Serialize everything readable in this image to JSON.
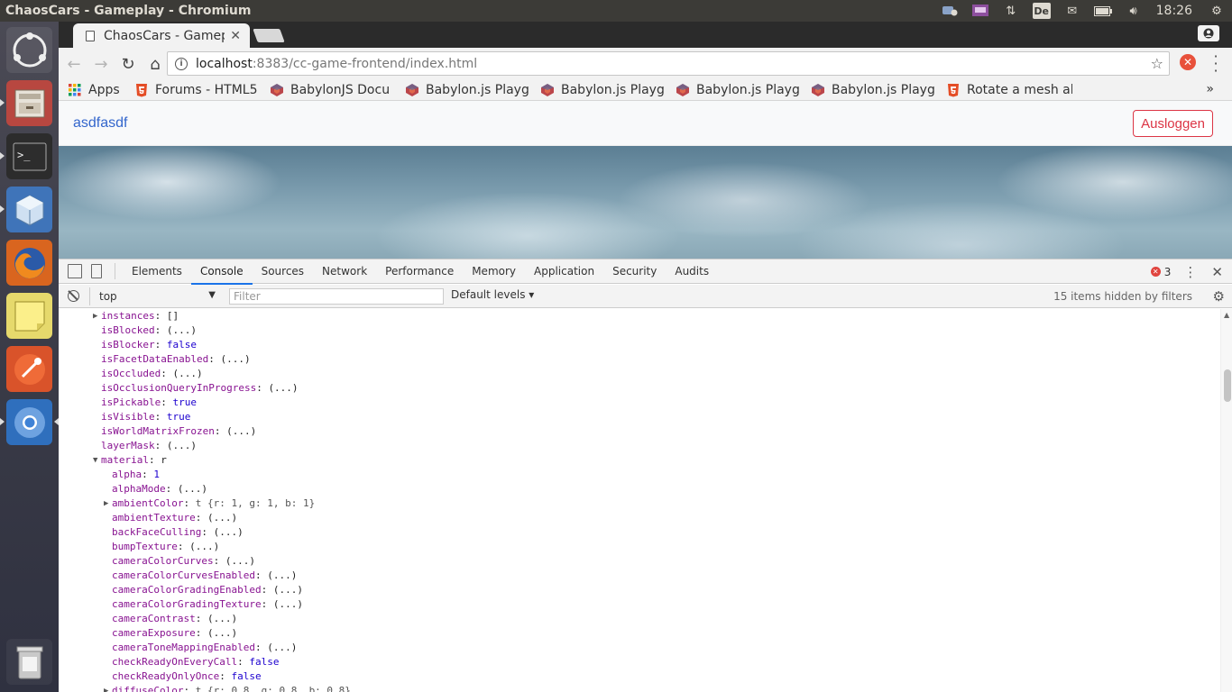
{
  "window": {
    "title": "ChaosCars - Gameplay - Chromium"
  },
  "tray": {
    "keyboard": "De",
    "clock": "18:26"
  },
  "browser": {
    "tab_title": "ChaosCars - Gamep",
    "url_host": "localhost",
    "url_path": ":8383/cc-game-frontend/index.html",
    "bookmarks": [
      {
        "label": "Apps",
        "icon": "apps-grid-icon"
      },
      {
        "label": "Forums - HTML5",
        "icon": "html5-icon"
      },
      {
        "label": "BabylonJS Docu",
        "icon": "babylonjs-icon"
      },
      {
        "label": "Babylon.js Playg",
        "icon": "babylonjs-icon"
      },
      {
        "label": "Babylon.js Playg",
        "icon": "babylonjs-icon"
      },
      {
        "label": "Babylon.js Playg",
        "icon": "babylonjs-icon"
      },
      {
        "label": "Babylon.js Playg",
        "icon": "babylonjs-icon"
      },
      {
        "label": "Rotate a mesh al",
        "icon": "html5-icon"
      }
    ],
    "bookmarks_more": "»"
  },
  "page": {
    "brand": "asdfasdf",
    "logout_label": "Ausloggen"
  },
  "devtools": {
    "tabs": [
      "Elements",
      "Console",
      "Sources",
      "Network",
      "Performance",
      "Memory",
      "Application",
      "Security",
      "Audits"
    ],
    "active_tab": "Console",
    "error_count": "3",
    "context": "top",
    "filter_placeholder": "Filter",
    "levels": "Default levels",
    "hidden_info": "15 items hidden by filters"
  },
  "console_lines": [
    {
      "indent": 0,
      "arrow": "right",
      "key": "instances",
      "value": "[]",
      "vclass": "p"
    },
    {
      "indent": 0,
      "arrow": "",
      "key": "isBlocked",
      "value": "(...)",
      "vclass": "p"
    },
    {
      "indent": 0,
      "arrow": "",
      "key": "isBlocker",
      "value": "false",
      "vclass": "vt"
    },
    {
      "indent": 0,
      "arrow": "",
      "key": "isFacetDataEnabled",
      "value": "(...)",
      "vclass": "p"
    },
    {
      "indent": 0,
      "arrow": "",
      "key": "isOccluded",
      "value": "(...)",
      "vclass": "p"
    },
    {
      "indent": 0,
      "arrow": "",
      "key": "isOcclusionQueryInProgress",
      "value": "(...)",
      "vclass": "p"
    },
    {
      "indent": 0,
      "arrow": "",
      "key": "isPickable",
      "value": "true",
      "vclass": "vt"
    },
    {
      "indent": 0,
      "arrow": "",
      "key": "isVisible",
      "value": "true",
      "vclass": "vt"
    },
    {
      "indent": 0,
      "arrow": "",
      "key": "isWorldMatrixFrozen",
      "value": "(...)",
      "vclass": "p"
    },
    {
      "indent": 0,
      "arrow": "",
      "key": "layerMask",
      "value": "(...)",
      "vclass": "p"
    },
    {
      "indent": 0,
      "arrow": "down",
      "key": "material",
      "value": "r",
      "vclass": "p"
    },
    {
      "indent": 1,
      "arrow": "",
      "key": "alpha",
      "value": "1",
      "vclass": "vn"
    },
    {
      "indent": 1,
      "arrow": "",
      "key": "alphaMode",
      "value": "(...)",
      "vclass": "p"
    },
    {
      "indent": 1,
      "arrow": "right",
      "key": "ambientColor",
      "value": "t {r: 1, g: 1, b: 1}",
      "vclass": "vs"
    },
    {
      "indent": 1,
      "arrow": "",
      "key": "ambientTexture",
      "value": "(...)",
      "vclass": "p"
    },
    {
      "indent": 1,
      "arrow": "",
      "key": "backFaceCulling",
      "value": "(...)",
      "vclass": "p"
    },
    {
      "indent": 1,
      "arrow": "",
      "key": "bumpTexture",
      "value": "(...)",
      "vclass": "p"
    },
    {
      "indent": 1,
      "arrow": "",
      "key": "cameraColorCurves",
      "value": "(...)",
      "vclass": "p"
    },
    {
      "indent": 1,
      "arrow": "",
      "key": "cameraColorCurvesEnabled",
      "value": "(...)",
      "vclass": "p"
    },
    {
      "indent": 1,
      "arrow": "",
      "key": "cameraColorGradingEnabled",
      "value": "(...)",
      "vclass": "p"
    },
    {
      "indent": 1,
      "arrow": "",
      "key": "cameraColorGradingTexture",
      "value": "(...)",
      "vclass": "p"
    },
    {
      "indent": 1,
      "arrow": "",
      "key": "cameraContrast",
      "value": "(...)",
      "vclass": "p"
    },
    {
      "indent": 1,
      "arrow": "",
      "key": "cameraExposure",
      "value": "(...)",
      "vclass": "p"
    },
    {
      "indent": 1,
      "arrow": "",
      "key": "cameraToneMappingEnabled",
      "value": "(...)",
      "vclass": "p"
    },
    {
      "indent": 1,
      "arrow": "",
      "key": "checkReadyOnEveryCall",
      "value": "false",
      "vclass": "vt"
    },
    {
      "indent": 1,
      "arrow": "",
      "key": "checkReadyOnlyOnce",
      "value": "false",
      "vclass": "vt"
    },
    {
      "indent": 1,
      "arrow": "right",
      "key": "diffuseColor",
      "value": "t {r: 0.8, g: 0.8, b: 0.8}",
      "vclass": "vs"
    }
  ],
  "colors": {
    "link": "#3366cc",
    "danger": "#dc3545",
    "devtools_accent": "#1a73e8",
    "console_key": "#881391"
  }
}
